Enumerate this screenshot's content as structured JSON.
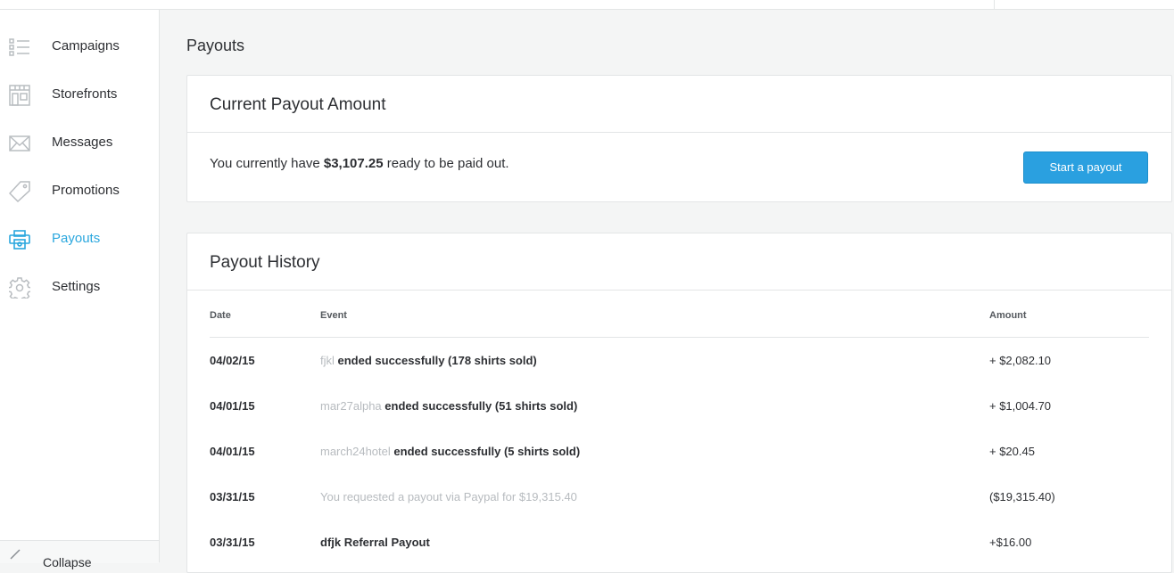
{
  "sidebar": {
    "items": [
      {
        "label": "Campaigns",
        "icon": "list-icon"
      },
      {
        "label": "Storefronts",
        "icon": "storefront-icon"
      },
      {
        "label": "Messages",
        "icon": "envelope-icon"
      },
      {
        "label": "Promotions",
        "icon": "tag-icon"
      },
      {
        "label": "Payouts",
        "icon": "payouts-icon",
        "active": true
      },
      {
        "label": "Settings",
        "icon": "gear-icon"
      }
    ],
    "collapse_label": "Collapse"
  },
  "page": {
    "title": "Payouts"
  },
  "current": {
    "title": "Current Payout Amount",
    "text_before": "You currently have ",
    "amount": "$3,107.25",
    "text_after": " ready to be paid out.",
    "button_label": "Start a payout"
  },
  "history": {
    "title": "Payout History",
    "headers": {
      "date": "Date",
      "event": "Event",
      "amount": "Amount"
    },
    "rows": [
      {
        "date": "04/02/15",
        "event_link": "fjkl",
        "event_text": " ended successfully (178 shirts sold)",
        "amount": "+ $2,082.10"
      },
      {
        "date": "04/01/15",
        "event_link": "mar27alpha",
        "event_text": " ended successfully (51 shirts sold)",
        "amount": "+ $1,004.70"
      },
      {
        "date": "04/01/15",
        "event_link": "march24hotel",
        "event_text": " ended successfully (5 shirts sold)",
        "amount": "+ $20.45"
      },
      {
        "date": "03/31/15",
        "event_muted": "You requested a payout via Paypal for $19,315.40",
        "amount": "($19,315.40)"
      },
      {
        "date": "03/31/15",
        "event_bold": "dfjk Referral Payout",
        "amount": "+$16.00"
      }
    ]
  },
  "colors": {
    "accent": "#2aa7de",
    "button": "#2aa0e0",
    "muted": "#b7bbbf"
  }
}
